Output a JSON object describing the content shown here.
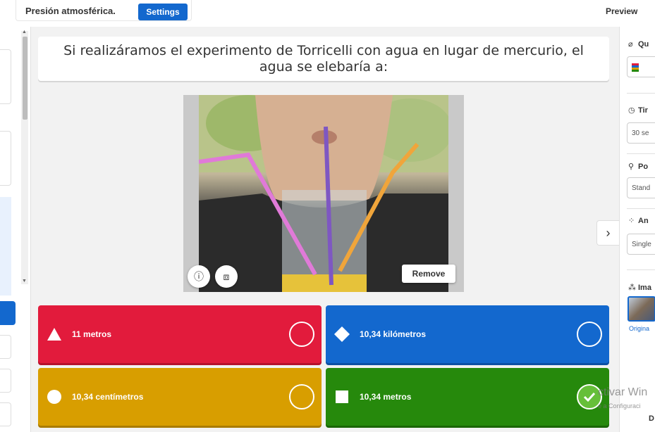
{
  "topbar": {
    "title": "Presión atmosférica.",
    "settings_label": "Settings",
    "preview_label": "Preview"
  },
  "question": {
    "text": "Si realizáramos el experimento de Torricelli con agua en lugar de mercurio, el agua se elebaría a:"
  },
  "media": {
    "remove_label": "Remove",
    "info_icon": "info-icon",
    "crop_icon": "crop-icon"
  },
  "answers": [
    {
      "shape": "triangle",
      "label": "11 metros",
      "color": "#e21b3c",
      "correct": false
    },
    {
      "shape": "diamond",
      "label": "10,34 kilómetros",
      "color": "#1368ce",
      "correct": false
    },
    {
      "shape": "circle",
      "label": "10,34 centímetros",
      "color": "#d89e00",
      "correct": false
    },
    {
      "shape": "square",
      "label": "10,34 metros",
      "color": "#26890c",
      "correct": true
    }
  ],
  "right_panel": {
    "question_type": {
      "heading": "Qu",
      "value": ""
    },
    "time_limit": {
      "heading": "Tir",
      "value": "30 se"
    },
    "points": {
      "heading": "Po",
      "value": "Stand"
    },
    "answer_options": {
      "heading": "An",
      "value": "Single"
    },
    "image_heading": "Ima",
    "original_link": "Origina"
  },
  "watermark": {
    "title": "ctivar Win",
    "subtitle": "e a Configuraci",
    "extra": "D"
  }
}
